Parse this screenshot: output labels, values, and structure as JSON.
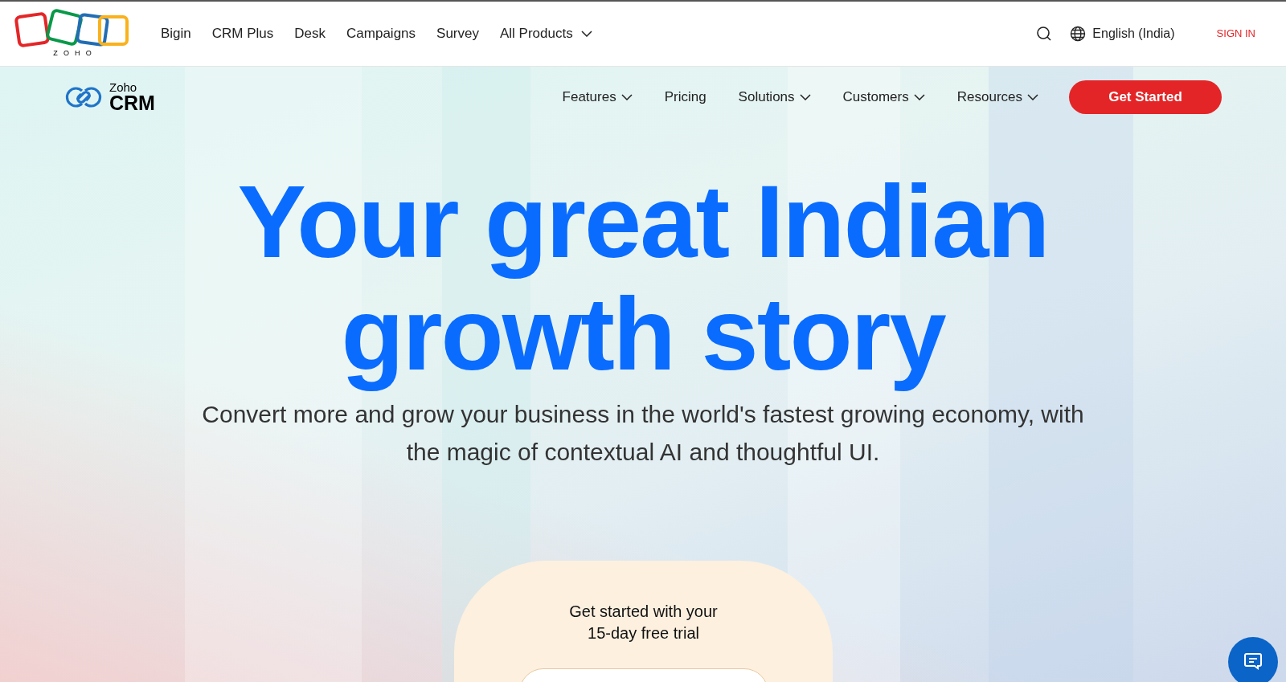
{
  "topbar": {
    "logo_text": "ZOHO",
    "products": [
      {
        "label": "Bigin",
        "has_menu": false
      },
      {
        "label": "CRM Plus",
        "has_menu": false
      },
      {
        "label": "Desk",
        "has_menu": false
      },
      {
        "label": "Campaigns",
        "has_menu": false
      },
      {
        "label": "Survey",
        "has_menu": false
      },
      {
        "label": "All Products",
        "has_menu": true
      }
    ],
    "language": "English (India)",
    "sign_in": "SIGN IN"
  },
  "navbar": {
    "brand_small": "Zoho",
    "brand_large": "CRM",
    "items": [
      {
        "label": "Features",
        "has_menu": true
      },
      {
        "label": "Pricing",
        "has_menu": false
      },
      {
        "label": "Solutions",
        "has_menu": true
      },
      {
        "label": "Customers",
        "has_menu": true
      },
      {
        "label": "Resources",
        "has_menu": true
      }
    ],
    "cta": "Get Started"
  },
  "hero": {
    "heading": [
      "Your great Indian",
      "growth story"
    ],
    "subtitle": "Convert more and grow your business in the world's fastest growing economy, with the magic of contextual AI and thoughtful UI."
  },
  "signup_card": {
    "title": [
      "Get started with your",
      "15-day free trial"
    ]
  }
}
